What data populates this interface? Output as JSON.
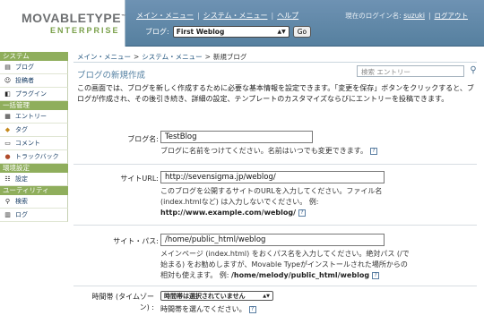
{
  "header": {
    "logo_main": "MOVABLETYPE",
    "logo_tm": "™",
    "logo_sub": "ENTERPRISE",
    "nav": [
      "メイン・メニュー",
      "システム・メニュー",
      "ヘルプ"
    ],
    "login_prefix": "現在のログイン名:",
    "username": "suzuki",
    "logout": "ログアウト",
    "blog_label": "ブログ:",
    "blog_selected": "First Weblog",
    "go_label": "Go"
  },
  "sidebar": {
    "sections": [
      {
        "title": "システム",
        "items": [
          {
            "label": "ブログ",
            "icon": "blog-icon"
          },
          {
            "label": "投稿者",
            "icon": "authors-icon"
          },
          {
            "label": "プラグイン",
            "icon": "plugin-icon"
          }
        ]
      },
      {
        "title": "一括管理",
        "items": [
          {
            "label": "エントリー",
            "icon": "entry-icon"
          },
          {
            "label": "タグ",
            "icon": "tag-icon"
          },
          {
            "label": "コメント",
            "icon": "comment-icon"
          },
          {
            "label": "トラックバック",
            "icon": "trackback-icon"
          }
        ]
      },
      {
        "title": "環境設定",
        "items": [
          {
            "label": "設定",
            "icon": "settings-icon"
          }
        ]
      },
      {
        "title": "ユーティリティ",
        "items": [
          {
            "label": "検索",
            "icon": "search-icon"
          },
          {
            "label": "ログ",
            "icon": "log-icon"
          }
        ]
      }
    ]
  },
  "breadcrumb": [
    "メイン・メニュー",
    "システム・メニュー",
    "新規ブログ"
  ],
  "page_title": "ブログの新規作成",
  "search_placeholder": "検索 エントリー",
  "intro": "この画面では、ブログを新しく作成するために必要な基本情報を設定できます。「変更を保存」ボタンをクリックすると、ブログが作成され、その後引き続き、詳細の設定、テンプレートのカスタマイズならびにエントリーを投稿できます。",
  "fields": {
    "blog_name": {
      "label": "ブログ名:",
      "value": "TestBlog",
      "help": "ブログに名前をつけてください。名前はいつでも変更できます。"
    },
    "site_url": {
      "label": "サイトURL:",
      "value": "http://sevensigma.jp/weblog/",
      "help": "このブログを公開するサイトのURLを入力してください。ファイル名(index.htmlなど) は入力しないでください。 例:",
      "example": "http://www.example.com/weblog/"
    },
    "site_path": {
      "label": "サイト・パス:",
      "value": "/home/public_html/weblog",
      "help": "メインページ (index.html) をおくパス名を入力してください。絶対パス (/で始まる) をお勧めしますが、Movable Typeがインストールされた場所からの相対も使えます。 例:",
      "example": "/home/melody/public_html/weblog"
    },
    "timezone": {
      "label_line1": "時間帯 (タイムゾー",
      "label_line2": "ン) :",
      "value": "時間帯は選択されていません",
      "help": "時間帯を選んでください。"
    }
  },
  "help_icon_glyph": "?"
}
